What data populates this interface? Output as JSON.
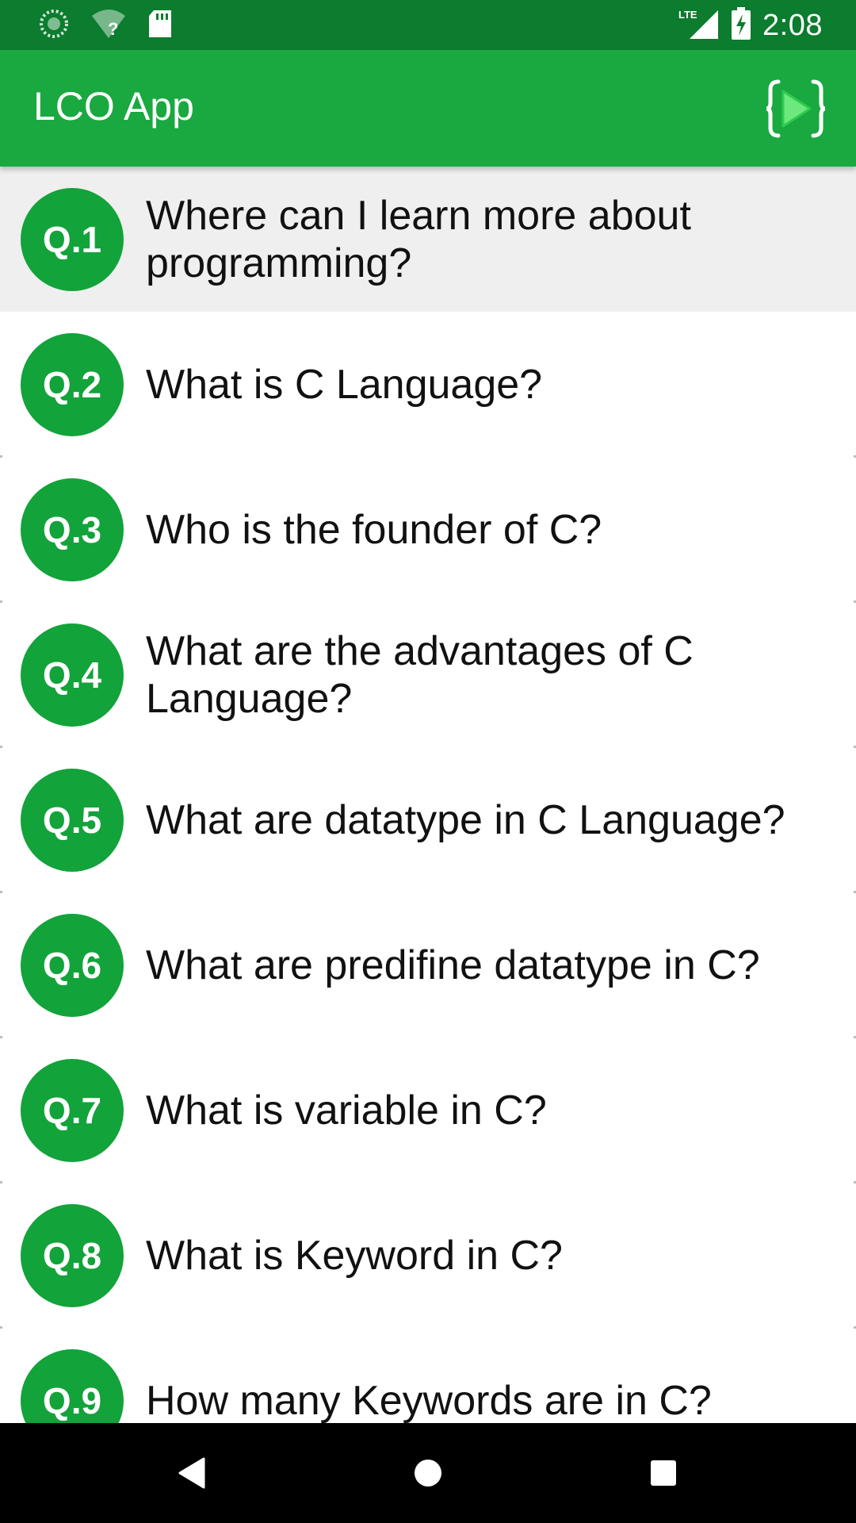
{
  "status_bar": {
    "time": "2:08",
    "network": "LTE",
    "icons": [
      "sync-icon",
      "wifi-unknown-icon",
      "sd-card-icon",
      "lte-signal-icon",
      "battery-charging-icon"
    ]
  },
  "app_bar": {
    "title": "LCO App",
    "action_icon": "code-run-icon"
  },
  "questions": [
    {
      "badge": "Q.1",
      "text": "Where can I learn more about programming?"
    },
    {
      "badge": "Q.2",
      "text": "What is C Language?"
    },
    {
      "badge": "Q.3",
      "text": "Who is the founder of C?"
    },
    {
      "badge": "Q.4",
      "text": "What are the advantages of C Language?"
    },
    {
      "badge": "Q.5",
      "text": "What are datatype in C Language?"
    },
    {
      "badge": "Q.6",
      "text": "What are predifine datatype in C?"
    },
    {
      "badge": "Q.7",
      "text": "What is variable in C?"
    },
    {
      "badge": "Q.8",
      "text": "What is Keyword in C?"
    },
    {
      "badge": "Q.9",
      "text": "How many Keywords are in C?"
    }
  ],
  "colors": {
    "status_bar": "#0c7c2e",
    "app_bar": "#19a940",
    "badge": "#12a33a",
    "selected_row": "#efefef",
    "nav_bar": "#000000"
  },
  "nav_bar": {
    "icons": [
      "back-icon",
      "home-icon",
      "recents-icon"
    ]
  }
}
